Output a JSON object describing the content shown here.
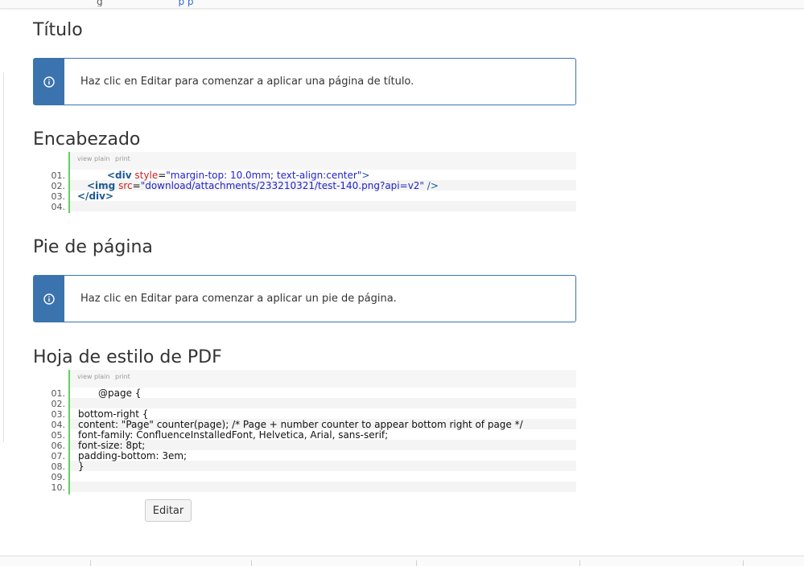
{
  "top_cut": {
    "text": "g",
    "link": "p p"
  },
  "sections": {
    "title": {
      "heading": "Título",
      "info": "Haz clic en Editar para comenzar a aplicar una página de título."
    },
    "header": {
      "heading": "Encabezado",
      "toolbar": {
        "view_plain": "view plain",
        "print": "print"
      },
      "line_numbers": [
        "01.",
        "02.",
        "03.",
        "04."
      ],
      "code": {
        "l1_open": "<div",
        "l1_attr": "style",
        "l1_eq": "=",
        "l1_val": "\"margin-top: 10.0mm; text-align:center\"",
        "l1_close": ">",
        "l2_open": "<img",
        "l2_attr": "src",
        "l2_eq": "=",
        "l2_val": "\"download/attachments/233210321/test-140.png?api=v2\"",
        "l2_close": "/>",
        "l3": "</div>"
      }
    },
    "footer": {
      "heading": "Pie de página",
      "info": "Haz clic en Editar para comenzar a aplicar un pie de página."
    },
    "pdf_stylesheet": {
      "heading": "Hoja de estilo de PDF",
      "toolbar": {
        "view_plain": "view plain",
        "print": "print"
      },
      "line_numbers": [
        "01.",
        "02.",
        "03.",
        "04.",
        "05.",
        "06.",
        "07.",
        "08.",
        "09.",
        "10."
      ],
      "code": [
        "@page {",
        "",
        "bottom-right {",
        "content: \"Page\" counter(page); /* Page + number counter to appear bottom right of page */",
        "font-family: ConfluenceInstalledFont, Helvetica, Arial, sans-serif;",
        "font-size: 8pt;",
        "padding-bottom: 3em;",
        "}",
        "",
        ""
      ]
    }
  },
  "edit_button": "Editar"
}
